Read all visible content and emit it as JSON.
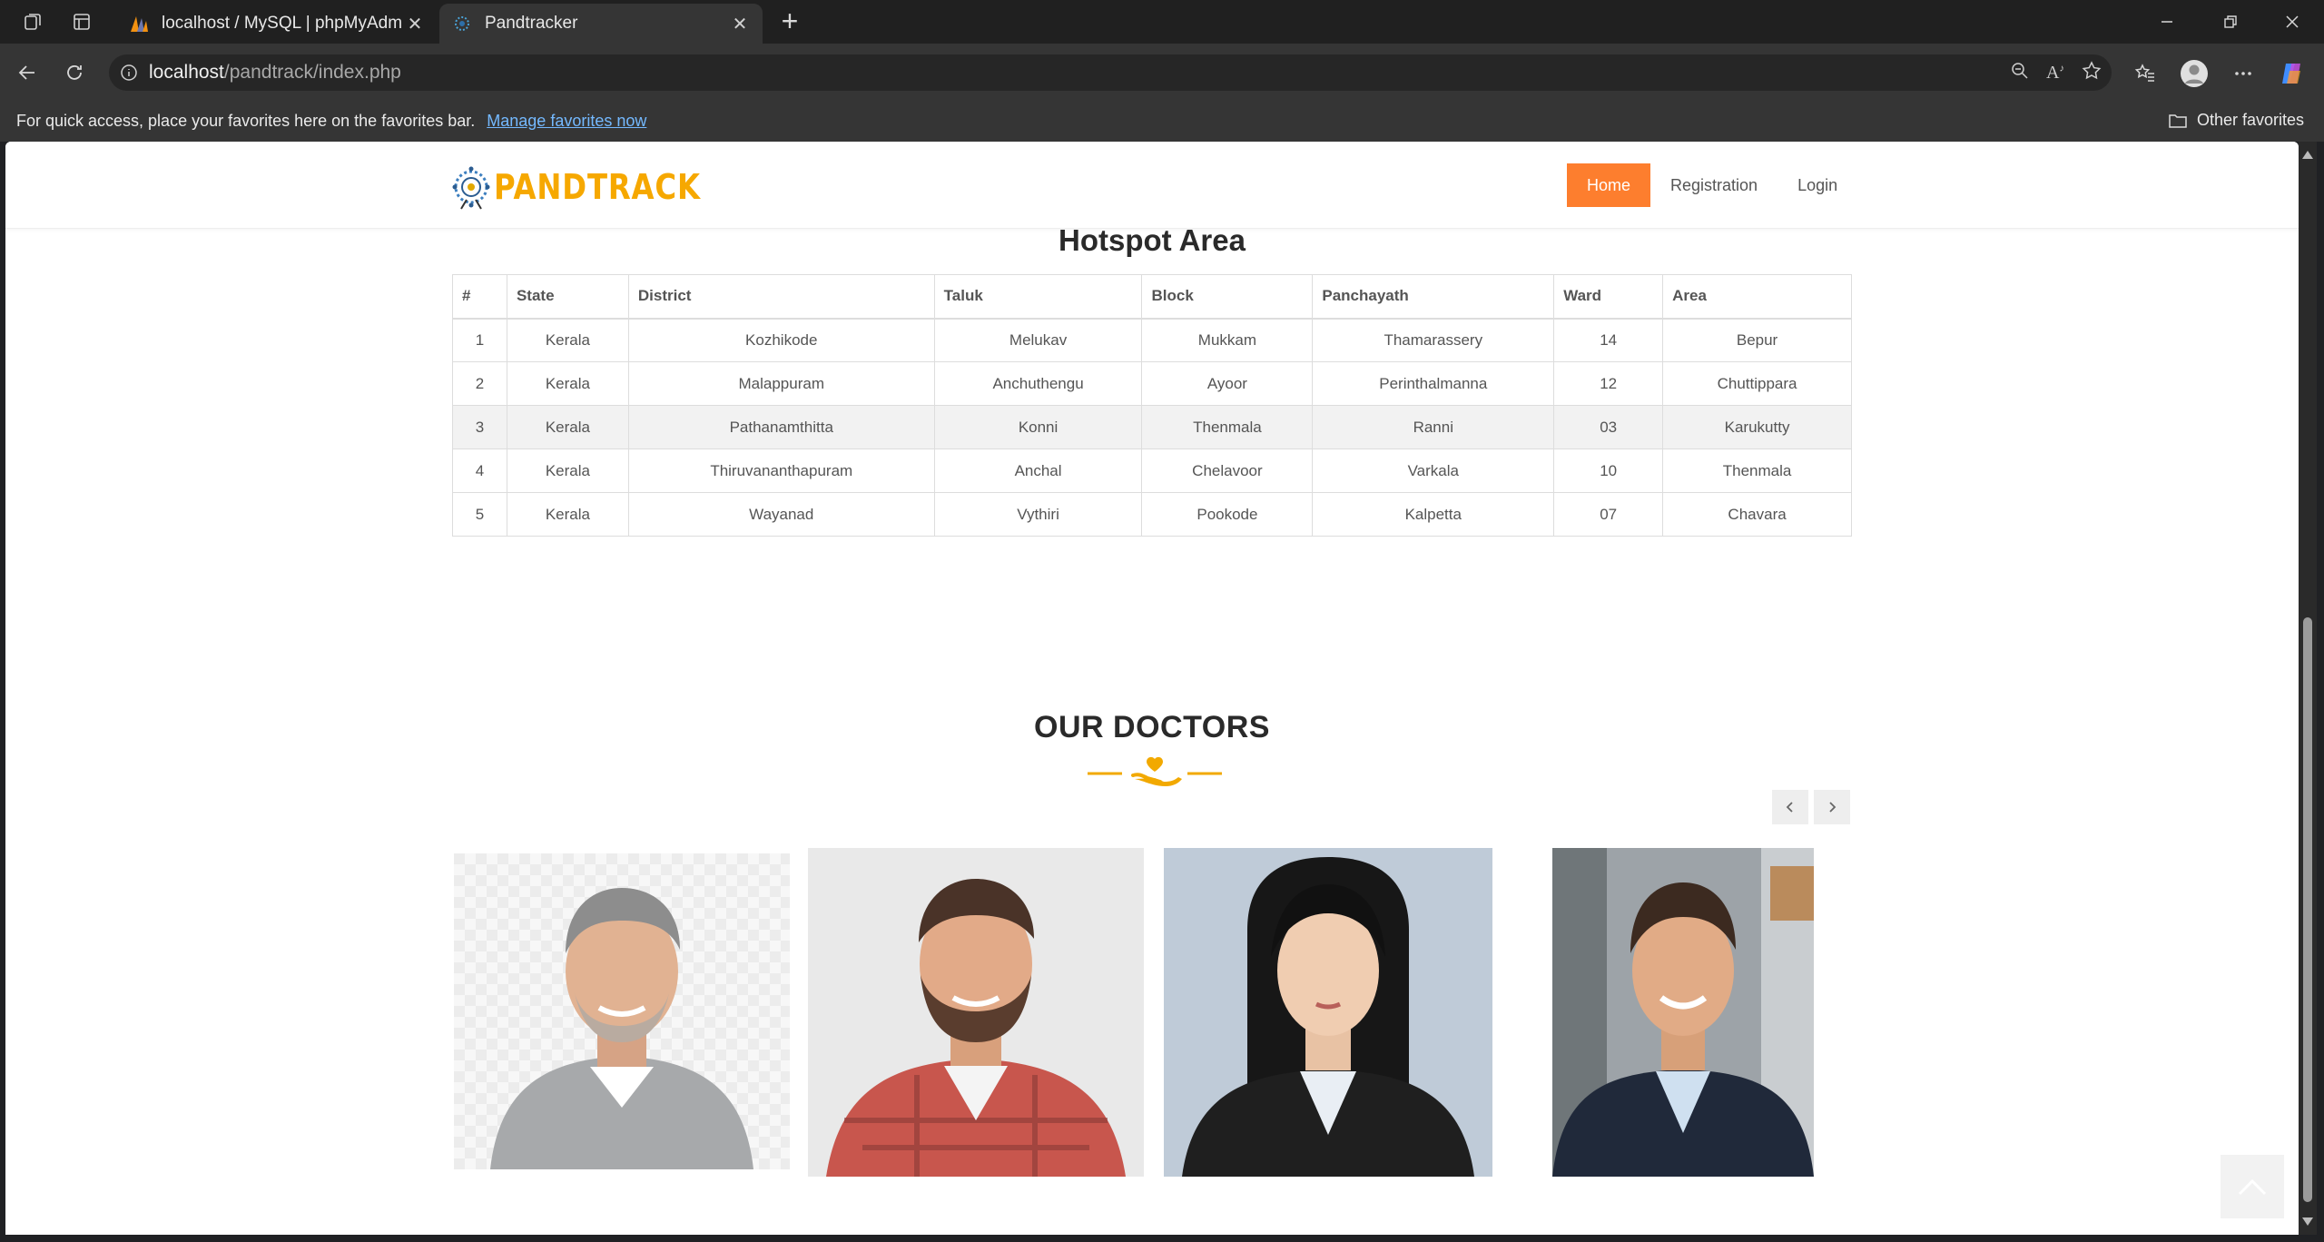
{
  "browser": {
    "tabs": [
      {
        "label": "localhost / MySQL | phpMyAdmin",
        "active": false
      },
      {
        "label": "Pandtracker",
        "active": true
      }
    ],
    "address": {
      "host": "localhost",
      "path": "/pandtrack/index.php"
    },
    "favorites_bar": {
      "message": "For quick access, place your favorites here on the favorites bar.",
      "manage_link": "Manage favorites now",
      "other_favorites": "Other favorites"
    }
  },
  "site": {
    "logo_text": "PANDTRACK",
    "nav": [
      {
        "label": "Home",
        "active": true
      },
      {
        "label": "Registration",
        "active": false
      },
      {
        "label": "Login",
        "active": false
      }
    ],
    "colors": {
      "accent": "#fd7e2e",
      "logo": "#f6a800"
    }
  },
  "hotspot": {
    "title": "Hotspot Area",
    "columns": [
      "#",
      "State",
      "District",
      "Taluk",
      "Block",
      "Panchayath",
      "Ward",
      "Area"
    ],
    "rows": [
      [
        "1",
        "Kerala",
        "Kozhikode",
        "Melukav",
        "Mukkam",
        "Thamarassery",
        "14",
        "Bepur"
      ],
      [
        "2",
        "Kerala",
        "Malappuram",
        "Anchuthengu",
        "Ayoor",
        "Perinthalmanna",
        "12",
        "Chuttippara"
      ],
      [
        "3",
        "Kerala",
        "Pathanamthitta",
        "Konni",
        "Thenmala",
        "Ranni",
        "03",
        "Karukutty"
      ],
      [
        "4",
        "Kerala",
        "Thiruvananthapuram",
        "Anchal",
        "Chelavoor",
        "Varkala",
        "10",
        "Thenmala"
      ],
      [
        "5",
        "Kerala",
        "Wayanad",
        "Vythiri",
        "Pookode",
        "Kalpetta",
        "07",
        "Chavara"
      ]
    ]
  },
  "doctors": {
    "title": "OUR DOCTORS",
    "prev_icon": "chevron-left-icon",
    "next_icon": "chevron-right-icon"
  }
}
